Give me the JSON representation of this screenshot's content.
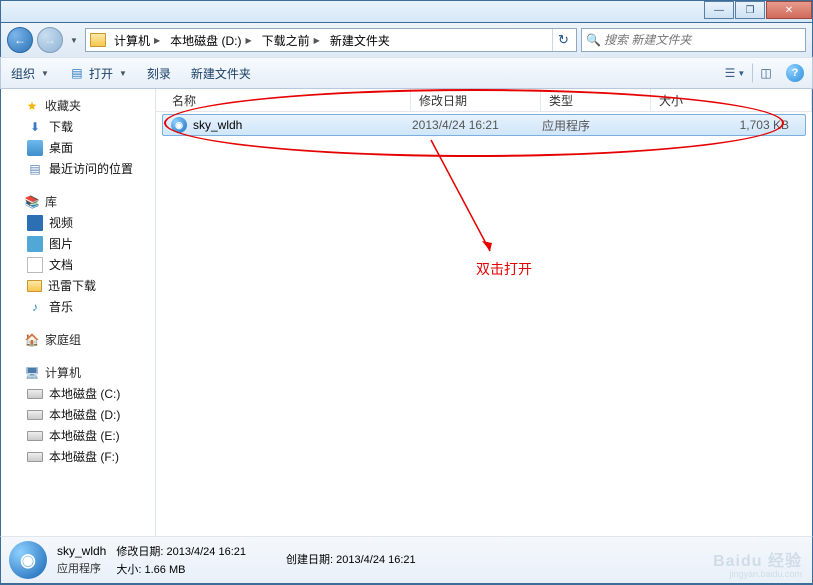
{
  "window": {
    "min": "—",
    "max": "❐",
    "close": "✕"
  },
  "nav": {
    "back": "←",
    "fwd": "→"
  },
  "breadcrumb": [
    {
      "label": "计算机"
    },
    {
      "label": "本地磁盘 (D:)"
    },
    {
      "label": "下载之前"
    },
    {
      "label": "新建文件夹"
    }
  ],
  "search": {
    "placeholder": "搜索 新建文件夹"
  },
  "toolbar": {
    "organize": "组织",
    "open": "打开",
    "burn": "刻录",
    "newfolder": "新建文件夹"
  },
  "columns": {
    "name": "名称",
    "date": "修改日期",
    "type": "类型",
    "size": "大小"
  },
  "sidebar": {
    "favorites": {
      "label": "收藏夹",
      "items": [
        {
          "label": "下载",
          "icon": "dl"
        },
        {
          "label": "桌面",
          "icon": "desk"
        },
        {
          "label": "最近访问的位置",
          "icon": "recent"
        }
      ]
    },
    "libraries": {
      "label": "库",
      "items": [
        {
          "label": "视频",
          "icon": "vid"
        },
        {
          "label": "图片",
          "icon": "pic"
        },
        {
          "label": "文档",
          "icon": "doc"
        },
        {
          "label": "迅雷下载",
          "icon": "folder"
        },
        {
          "label": "音乐",
          "icon": "music"
        }
      ]
    },
    "homegroup": {
      "label": "家庭组"
    },
    "computer": {
      "label": "计算机",
      "items": [
        {
          "label": "本地磁盘 (C:)"
        },
        {
          "label": "本地磁盘 (D:)"
        },
        {
          "label": "本地磁盘 (E:)"
        },
        {
          "label": "本地磁盘 (F:)"
        }
      ]
    }
  },
  "files": [
    {
      "name": "sky_wldh",
      "date": "2013/4/24 16:21",
      "type": "应用程序",
      "size": "1,703 KB",
      "selected": true
    }
  ],
  "annotation": {
    "text": "双击打开"
  },
  "details": {
    "name": "sky_wldh",
    "type": "应用程序",
    "mod_label": "修改日期:",
    "mod_value": "2013/4/24 16:21",
    "size_label": "大小:",
    "size_value": "1.66 MB",
    "created_label": "创建日期:",
    "created_value": "2013/4/24 16:21"
  },
  "watermark": {
    "brand": "Baidu 经验",
    "url": "jingyan.baidu.com"
  }
}
